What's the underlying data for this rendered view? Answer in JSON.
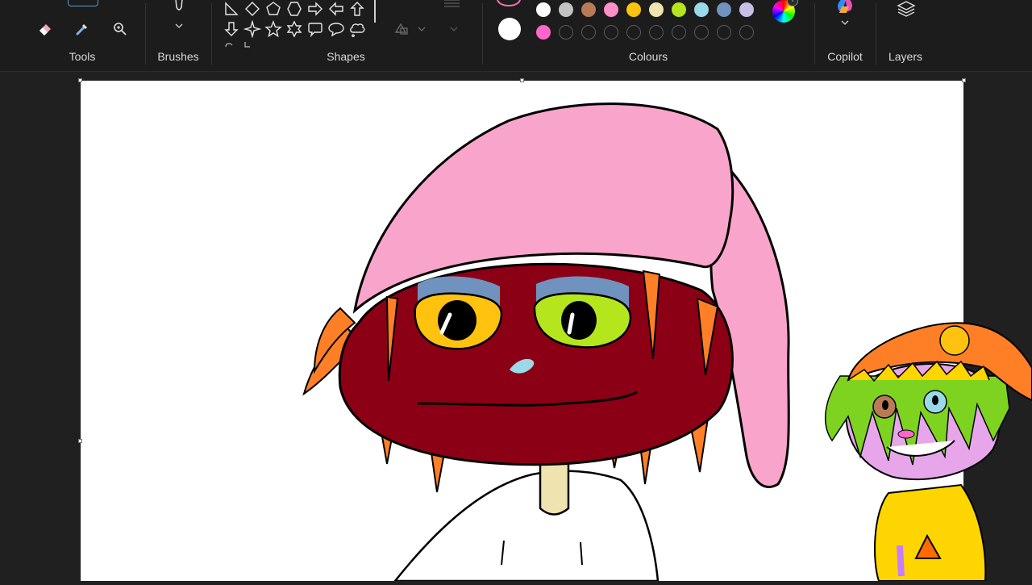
{
  "ribbon": {
    "groups": {
      "tools": "Tools",
      "brushes": "Brushes",
      "shapes": "Shapes",
      "colours": "Colours",
      "copilot": "Copilot",
      "layers": "Layers"
    },
    "icons": {
      "eraser": "eraser-icon",
      "color_picker": "color-picker-icon",
      "magnifier": "magnifier-icon",
      "brush": "brush-icon",
      "chevron": "chevron-down-icon",
      "copilot": "copilot-icon",
      "layers": "layers-icon"
    },
    "shapes": [
      "right-triangle",
      "diamond",
      "pentagon",
      "hexagon",
      "arrow-right",
      "arrow-left",
      "arrow-up",
      "arrow-down",
      "four-point-star",
      "five-point-star",
      "six-point-star",
      "rounded-callout",
      "oval-callout",
      "cloud-callout"
    ],
    "colours": {
      "primary": "#f472b6",
      "secondary": "#ffffff",
      "row1": [
        "#ffffff",
        "#c3c3c3",
        "#b97a57",
        "#ff8fc7",
        "#ffc20e",
        "#efe4b0",
        "#b5e61d",
        "#99d9ea",
        "#7092be",
        "#c8bfe7"
      ],
      "row2_first": "#ff66cc",
      "row2_empty_count": 9
    }
  },
  "canvas": {
    "background": "#ffffff",
    "drawing": "cartoon-character-pink-hat",
    "sticker": "cartoon-character-orange-hat"
  }
}
